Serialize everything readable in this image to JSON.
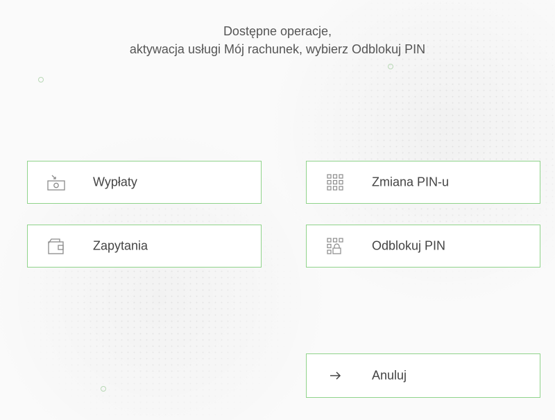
{
  "header": {
    "line1": "Dostępne operacje,",
    "line2": "aktywacja usługi Mój rachunek, wybierz Odblokuj PIN"
  },
  "menu": {
    "items": [
      {
        "label": "Wypłaty",
        "icon": "cash-withdrawal-icon"
      },
      {
        "label": "Zapytania",
        "icon": "wallet-icon"
      },
      {
        "label": "Zmiana PIN-u",
        "icon": "keypad-icon"
      },
      {
        "label": "Odblokuj PIN",
        "icon": "keypad-lock-icon"
      }
    ],
    "cancel": {
      "label": "Anuluj",
      "icon": "arrow-right-icon"
    }
  },
  "colors": {
    "accent_border": "#8fd38a",
    "text": "#444444",
    "icon": "#8a8a8a"
  }
}
